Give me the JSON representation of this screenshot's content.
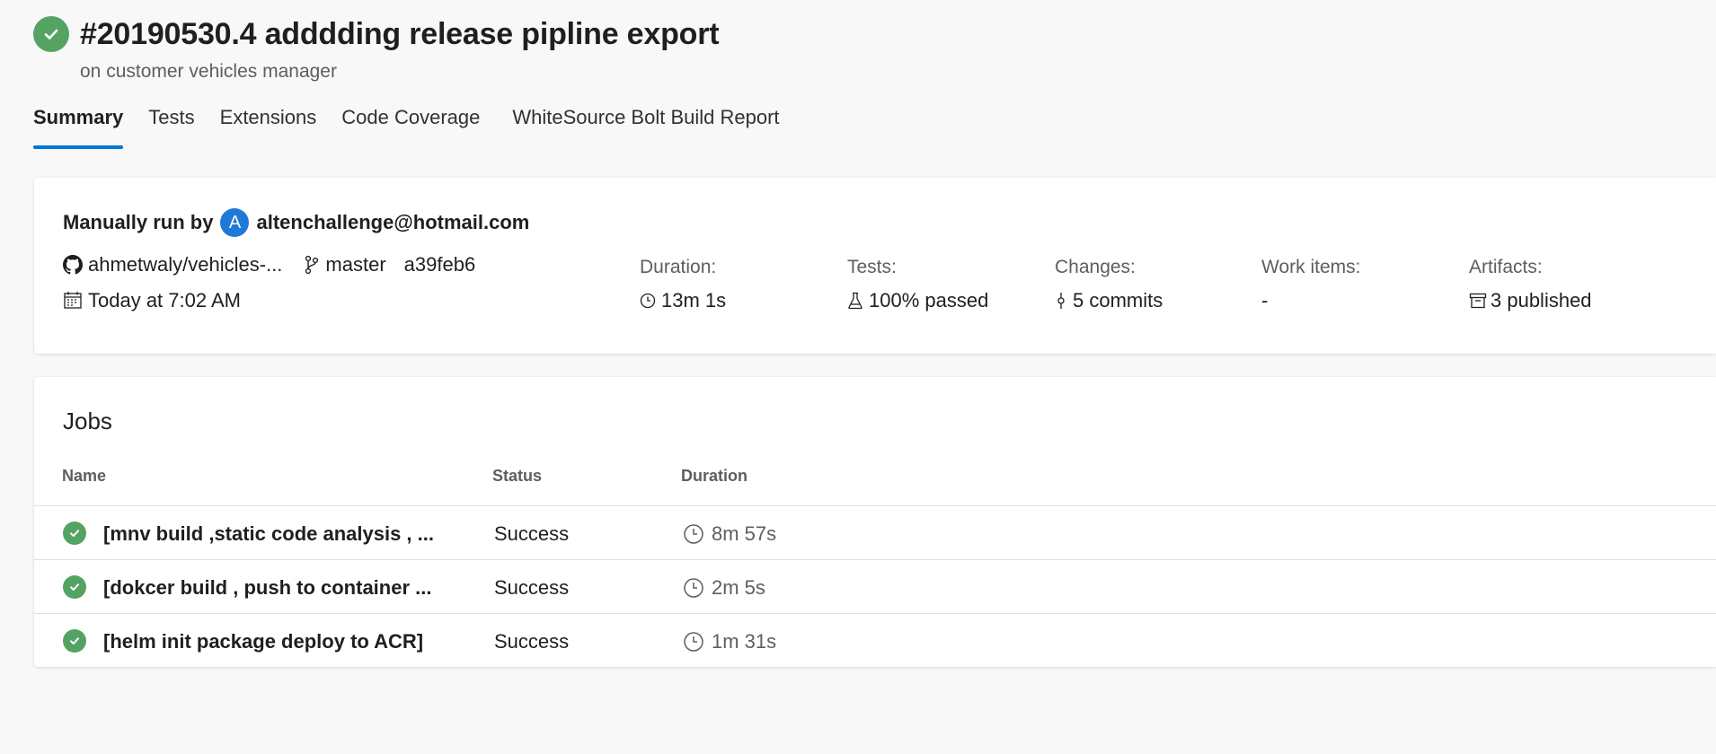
{
  "header": {
    "title": "#20190530.4 adddding release pipline export",
    "subtitle": "on customer vehicles manager",
    "status_icon": "check-circle-icon",
    "status_color": "#55a362"
  },
  "tabs": [
    "Summary",
    "Tests",
    "Extensions",
    "Code Coverage",
    "WhiteSource Bolt Build Report"
  ],
  "summary": {
    "run_by_prefix": "Manually run by",
    "avatar_letter": "A",
    "run_by_user": "altenchallenge@hotmail.com",
    "repo": "ahmetwaly/vehicles-...",
    "branch": "master",
    "commit": "a39feb6",
    "time": "Today at 7:02 AM",
    "duration_label": "Duration:",
    "duration_value": "13m 1s",
    "tests_label": "Tests:",
    "tests_value": "100% passed",
    "changes_label": "Changes:",
    "changes_value": "5 commits",
    "work_items_label": "Work items:",
    "work_items_value": "-",
    "artifacts_label": "Artifacts:",
    "artifacts_value": "3 published"
  },
  "jobs": {
    "title": "Jobs",
    "columns": [
      "Name",
      "Status",
      "Duration"
    ],
    "rows": [
      {
        "name": "[mnv build ,static code analysis , ...",
        "status": "Success",
        "duration": "8m 57s"
      },
      {
        "name": "[dokcer build , push to container ...",
        "status": "Success",
        "duration": "2m 5s"
      },
      {
        "name": "[helm init package deploy to ACR]",
        "status": "Success",
        "duration": "1m 31s"
      }
    ]
  },
  "colors": {
    "accent": "#0078d4",
    "success": "#55a362",
    "avatar": "#1e7ad6"
  }
}
